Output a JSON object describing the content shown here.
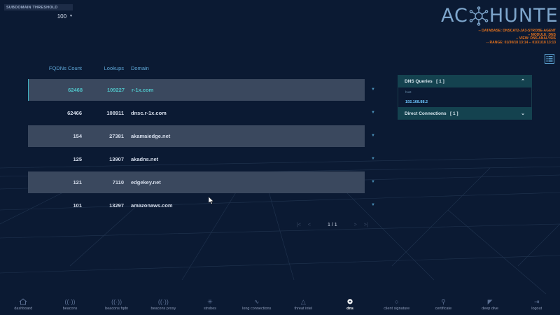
{
  "threshold": {
    "label": "SUBDOMAIN THRESHOLD",
    "value": "100"
  },
  "logo": {
    "left": "AC",
    "right": "HUNTER"
  },
  "meta": [
    "-- DATABASE: DNSCAT2-JA3-STROBE-AGENT",
    "-- MODULE: DNS",
    "-- VIEW: DNS ANALYSIS",
    "-- RANGE: 01/30/18 13:14 -- 01/31/18 13:13"
  ],
  "table": {
    "headers": {
      "fqdn": "FQDNs Count",
      "lookups": "Lookups",
      "domain": "Domain"
    },
    "rows": [
      {
        "fqdn": "62468",
        "lookups": "109227",
        "domain": "r-1x.com"
      },
      {
        "fqdn": "62466",
        "lookups": "108911",
        "domain": "dnsc.r-1x.com"
      },
      {
        "fqdn": "154",
        "lookups": "27381",
        "domain": "akamaiedge.net"
      },
      {
        "fqdn": "125",
        "lookups": "13907",
        "domain": "akadns.net"
      },
      {
        "fqdn": "121",
        "lookups": "7110",
        "domain": "edgekey.net"
      },
      {
        "fqdn": "101",
        "lookups": "13297",
        "domain": "amazonaws.com"
      }
    ]
  },
  "pager": {
    "text": "1 / 1"
  },
  "panel": {
    "dns_title": "DNS Queries",
    "dns_count": "[ 1 ]",
    "host_label": "host",
    "host_ip": "192.168.88.2",
    "direct_title": "Direct Connections",
    "direct_count": "[ 1 ]"
  },
  "nav": [
    {
      "label": "dashboard",
      "icon": "home-icon"
    },
    {
      "label": "beacons",
      "icon": "beacon-icon"
    },
    {
      "label": "beacons fqdn",
      "icon": "beacon-icon"
    },
    {
      "label": "beacons proxy",
      "icon": "beacon-icon"
    },
    {
      "label": "strobes",
      "icon": "strobe-icon"
    },
    {
      "label": "long connections",
      "icon": "connection-icon"
    },
    {
      "label": "threat intel",
      "icon": "warning-icon"
    },
    {
      "label": "dns",
      "icon": "dns-icon"
    },
    {
      "label": "client signature",
      "icon": "signature-icon"
    },
    {
      "label": "certificate",
      "icon": "certificate-icon"
    },
    {
      "label": "deep dive",
      "icon": "deep-dive-icon"
    },
    {
      "label": "logout",
      "icon": "logout-icon"
    }
  ],
  "nav_active": "dns",
  "colors": {
    "accent": "#4fc3c8",
    "meta": "#e2711d",
    "background": "#0b1a33",
    "row_shade": "#3a485e"
  }
}
